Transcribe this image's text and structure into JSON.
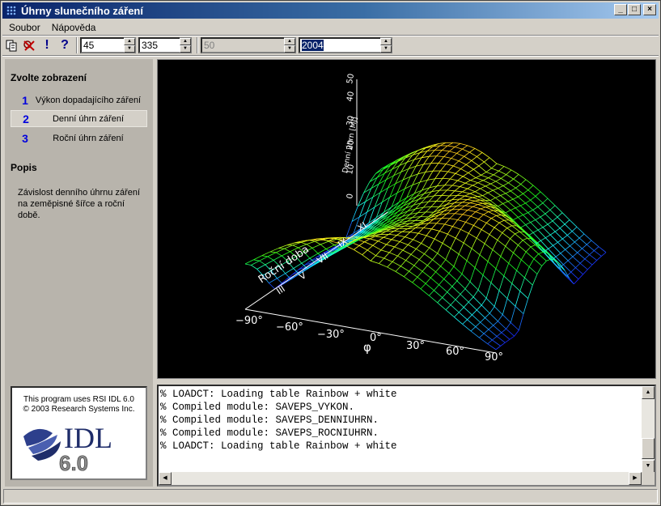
{
  "window": {
    "title": "Úhrny slunečního záření"
  },
  "menu": {
    "items": [
      "Soubor",
      "Nápověda"
    ]
  },
  "toolbar": {
    "spin1": "45",
    "spin2": "335",
    "spin3": "50",
    "spin4": "2004"
  },
  "left": {
    "heading": "Zvolte zobrazení",
    "views": [
      {
        "num": "1",
        "label": "Výkon dopadajícího záření"
      },
      {
        "num": "2",
        "label": "Denní úhrn záření"
      },
      {
        "num": "3",
        "label": "Roční úhrn záření"
      }
    ],
    "desc_heading": "Popis",
    "desc_text": "Závislost denního úhrnu záření na zeměpisné šířce a roční době.",
    "idl_line1": "This program uses RSI IDL 6.0",
    "idl_line2": "© 2003 Research Systems Inc.",
    "idl_logo": "IDL",
    "idl_version": "6.0"
  },
  "plot": {
    "z_label": "Denní úhrn [MJ]",
    "z_ticks": [
      "0",
      "10",
      "20",
      "30",
      "40",
      "50"
    ],
    "y_label": "Roční doba",
    "y_ticks": [
      "III",
      "V",
      "VII",
      "IX",
      "XI"
    ],
    "x_label": "φ",
    "x_ticks": [
      "−90°",
      "−60°",
      "−30°",
      "0°",
      "30°",
      "60°",
      "90°"
    ]
  },
  "console": {
    "lines": [
      "% LOADCT: Loading table Rainbow + white",
      "% Compiled module: SAVEPS_VYKON.",
      "% Compiled module: SAVEPS_DENNIUHRN.",
      "% Compiled module: SAVEPS_ROCNIUHRN.",
      "% LOADCT: Loading table Rainbow + white"
    ]
  }
}
